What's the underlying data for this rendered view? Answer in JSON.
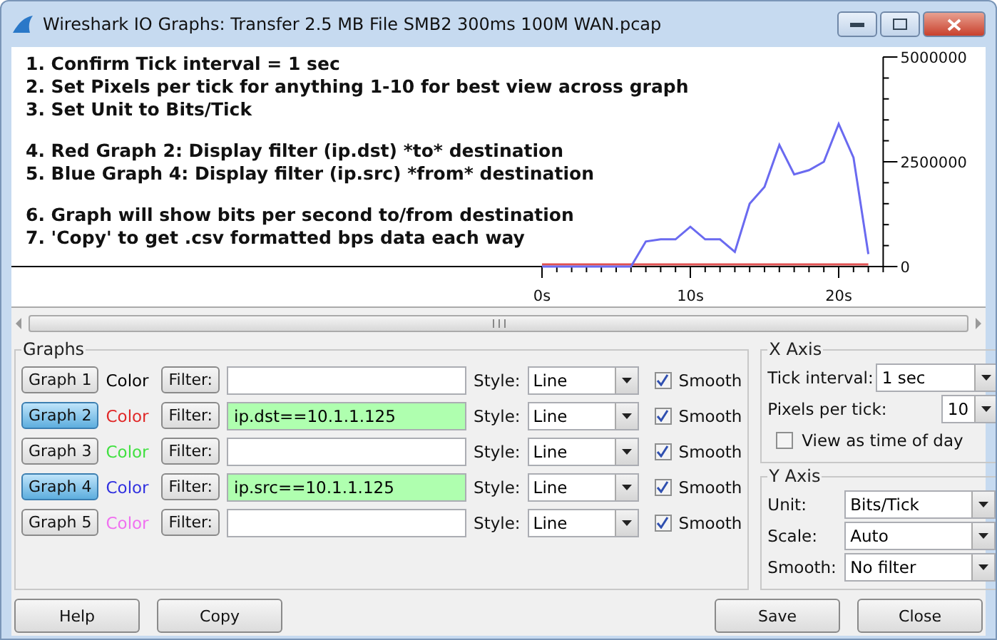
{
  "window": {
    "title": "Wireshark IO Graphs: Transfer 2.5 MB File SMB2 300ms 100M WAN.pcap"
  },
  "instructions": [
    [
      "1. Confirm Tick interval = 1 sec",
      "2. Set Pixels per tick for anything 1-10 for best view across graph",
      "3. Set Unit to Bits/Tick"
    ],
    [
      "4. Red Graph 2: Display filter (ip.dst) *to* destination",
      "5. Blue Graph 4: Display filter (ip.src) *from* destination"
    ],
    [
      "6. Graph will show bits per second to/from destination",
      "7. 'Copy' to get .csv formatted bps data each way"
    ]
  ],
  "chart_data": {
    "type": "line",
    "x": [
      0,
      1,
      2,
      3,
      4,
      5,
      6,
      7,
      8,
      9,
      10,
      11,
      12,
      13,
      14,
      15,
      16,
      17,
      18,
      19,
      20,
      21,
      22
    ],
    "series": [
      {
        "color": "#e05050",
        "values": [
          50000,
          50000,
          50000,
          50000,
          50000,
          50000,
          50000,
          50000,
          50000,
          50000,
          50000,
          50000,
          50000,
          50000,
          50000,
          50000,
          50000,
          50000,
          50000,
          50000,
          50000,
          50000,
          50000
        ]
      },
      {
        "color": "#6a6af0",
        "values": [
          0,
          0,
          0,
          0,
          0,
          0,
          0,
          600000,
          650000,
          650000,
          950000,
          650000,
          650000,
          350000,
          1500000,
          1900000,
          2900000,
          2200000,
          2300000,
          2500000,
          3400000,
          2600000,
          300000
        ]
      }
    ],
    "xlim": [
      -37,
      23
    ],
    "ylim": [
      0,
      5000000
    ],
    "xticks": [
      {
        "value": 0,
        "label": "0s"
      },
      {
        "value": 10,
        "label": "10s"
      },
      {
        "value": 20,
        "label": "20s"
      }
    ],
    "yticks": [
      0,
      2500000,
      5000000
    ]
  },
  "graphs_group": {
    "title": "Graphs",
    "graphs": [
      {
        "label": "Graph 1",
        "selected": false,
        "color_label": "Color",
        "color": "#000000",
        "filter_button": "Filter:",
        "style_label": "Style:",
        "style": "Line",
        "smooth_label": "Smooth",
        "smooth": true
      },
      {
        "label": "Graph 2",
        "selected": true,
        "color_label": "Color",
        "color": "#e02828",
        "filter_button": "Filter:",
        "filter": "ip.dst==10.1.1.125",
        "style_label": "Style:",
        "style": "Line",
        "smooth_label": "Smooth",
        "smooth": true
      },
      {
        "label": "Graph 3",
        "selected": false,
        "color_label": "Color",
        "color": "#40e040",
        "filter_button": "Filter:",
        "style_label": "Style:",
        "style": "Line",
        "smooth_label": "Smooth",
        "smooth": true
      },
      {
        "label": "Graph 4",
        "selected": true,
        "color_label": "Color",
        "color": "#3030e0",
        "filter_button": "Filter:",
        "filter": "ip.src==10.1.1.125",
        "style_label": "Style:",
        "style": "Line",
        "smooth_label": "Smooth",
        "smooth": true
      },
      {
        "label": "Graph 5",
        "selected": false,
        "color_label": "Color",
        "color": "#f070f0",
        "filter_button": "Filter:",
        "style_label": "Style:",
        "style": "Line",
        "smooth_label": "Smooth",
        "smooth": true
      }
    ]
  },
  "x_axis": {
    "title": "X Axis",
    "tick_interval_label": "Tick interval:",
    "tick_interval": "1 sec",
    "pixels_label": "Pixels per tick:",
    "pixels": "10",
    "time_of_day_label": "View as time of day",
    "time_of_day": false
  },
  "y_axis": {
    "title": "Y Axis",
    "fields": [
      {
        "label": "Unit:",
        "value": "Bits/Tick"
      },
      {
        "label": "Scale:",
        "value": "Auto"
      },
      {
        "label": "Smooth:",
        "value": "No filter"
      }
    ]
  },
  "buttons_left": [
    "Help",
    "Copy"
  ],
  "buttons_right": [
    "Save",
    "Close"
  ]
}
